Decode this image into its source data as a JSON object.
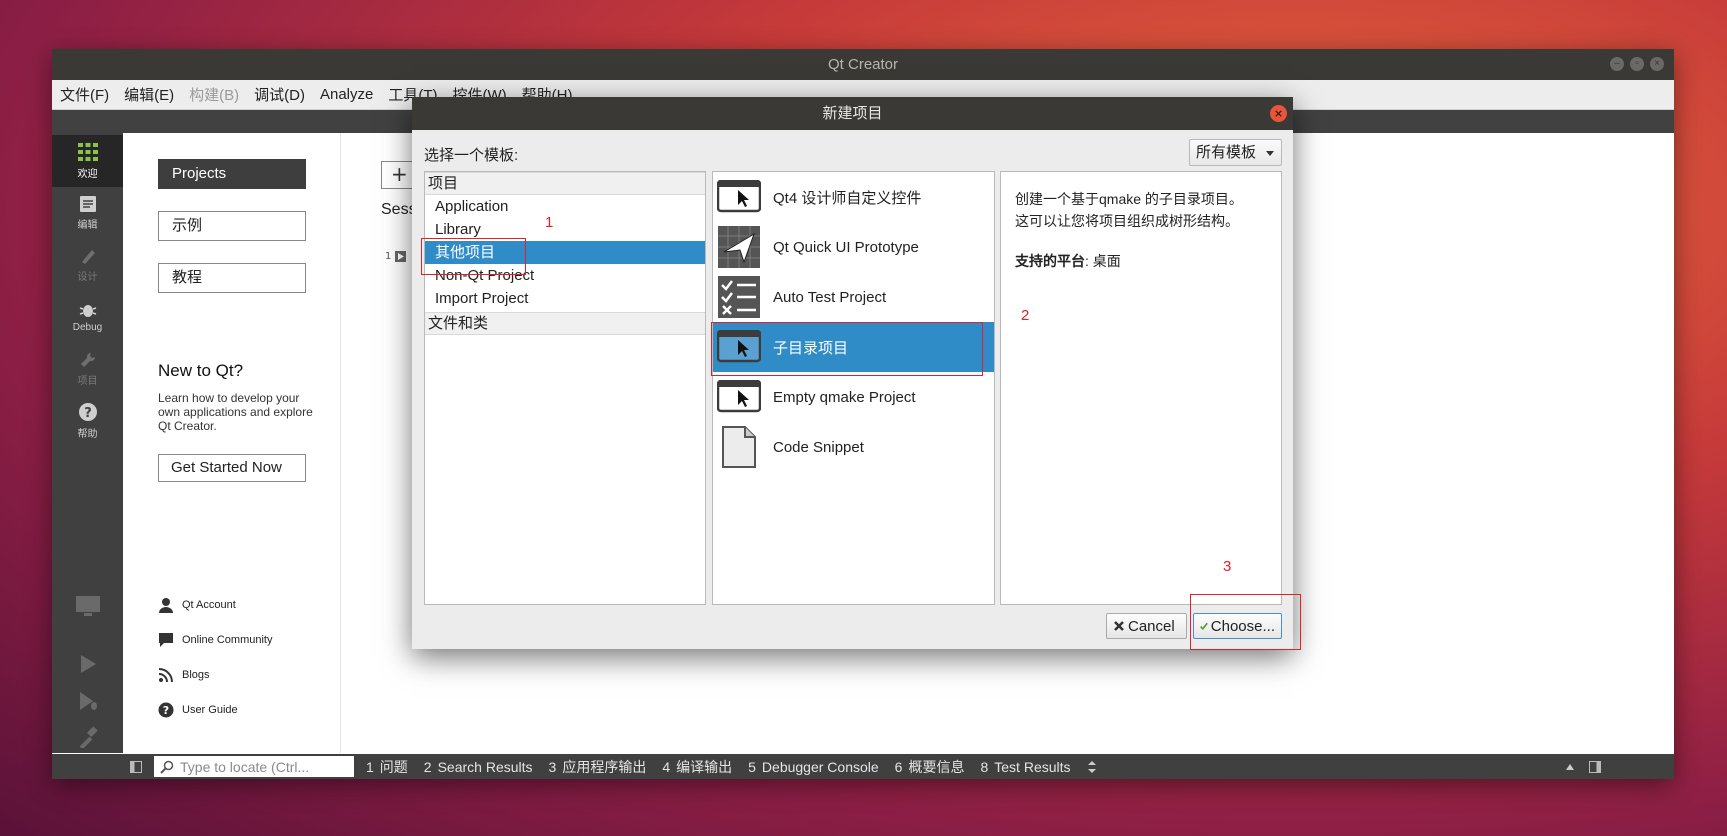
{
  "window": {
    "title": "Qt Creator"
  },
  "menubar": [
    {
      "label": "文件(F)",
      "enabled": true
    },
    {
      "label": "编辑(E)",
      "enabled": true
    },
    {
      "label": "构建(B)",
      "enabled": false
    },
    {
      "label": "调试(D)",
      "enabled": true
    },
    {
      "label": "Analyze",
      "enabled": true
    },
    {
      "label": "工具(T)",
      "enabled": true
    },
    {
      "label": "控件(W)",
      "enabled": true
    },
    {
      "label": "帮助(H)",
      "enabled": true
    }
  ],
  "modes": [
    {
      "label": "欢迎",
      "icon": "welcome-grid-icon",
      "active": true
    },
    {
      "label": "编辑",
      "icon": "edit-document-icon"
    },
    {
      "label": "设计",
      "icon": "design-pen-icon",
      "dim": true
    },
    {
      "label": "Debug",
      "icon": "debug-bug-icon"
    },
    {
      "label": "项目",
      "icon": "projects-wrench-icon",
      "dim": true
    },
    {
      "label": "帮助",
      "icon": "help-question-icon"
    }
  ],
  "welcome": {
    "sidebar_buttons": [
      "Projects",
      "示例",
      "教程"
    ],
    "new_to_qt_title": "New to Qt?",
    "new_to_qt_desc": "Learn how to develop your own applications and explore Qt Creator.",
    "get_started": "Get Started Now",
    "links": [
      "Qt Account",
      "Online Community",
      "Blogs",
      "User Guide"
    ],
    "plus_label": "+",
    "sessions_label": "Sessio",
    "session_row_number": "1"
  },
  "statusbar": {
    "locate_placeholder": "Type to locate (Ctrl...",
    "panes": [
      {
        "num": "1",
        "label": "问题"
      },
      {
        "num": "2",
        "label": "Search Results"
      },
      {
        "num": "3",
        "label": "应用程序输出"
      },
      {
        "num": "4",
        "label": "编译输出"
      },
      {
        "num": "5",
        "label": "Debugger Console"
      },
      {
        "num": "6",
        "label": "概要信息"
      },
      {
        "num": "8",
        "label": "Test Results"
      }
    ]
  },
  "dialog": {
    "title": "新建项目",
    "choose_template_label": "选择一个模板:",
    "filter_value": "所有模板",
    "categories": {
      "header1": "项目",
      "items": [
        "Application",
        "Library",
        "其他项目",
        "Non-Qt Project",
        "Import Project"
      ],
      "selected_index": 2,
      "header2": "文件和类"
    },
    "templates": [
      {
        "label": "Qt4 设计师自定义控件",
        "icon": "qt-designer-widget-icon"
      },
      {
        "label": "Qt Quick UI Prototype",
        "icon": "qt-quick-prototype-icon"
      },
      {
        "label": "Auto Test Project",
        "icon": "auto-test-checklist-icon"
      },
      {
        "label": "子目录项目",
        "icon": "subdirs-project-icon"
      },
      {
        "label": "Empty qmake Project",
        "icon": "empty-qmake-project-icon"
      },
      {
        "label": "Code Snippet",
        "icon": "code-snippet-file-icon"
      }
    ],
    "selected_template_index": 3,
    "description_line1": "创建一个基于qmake 的子目录项目。",
    "description_line2": "这可以让您将项目组织成树形结构。",
    "platforms_label": "支持的平台",
    "platforms_value": ": 桌面",
    "cancel_label": "Cancel",
    "choose_label": "Choose..."
  },
  "annotations": [
    "1",
    "2",
    "3"
  ],
  "colors": {
    "selection": "#308cc6",
    "annotation": "#e0202a",
    "titlebar": "#3a3935"
  }
}
